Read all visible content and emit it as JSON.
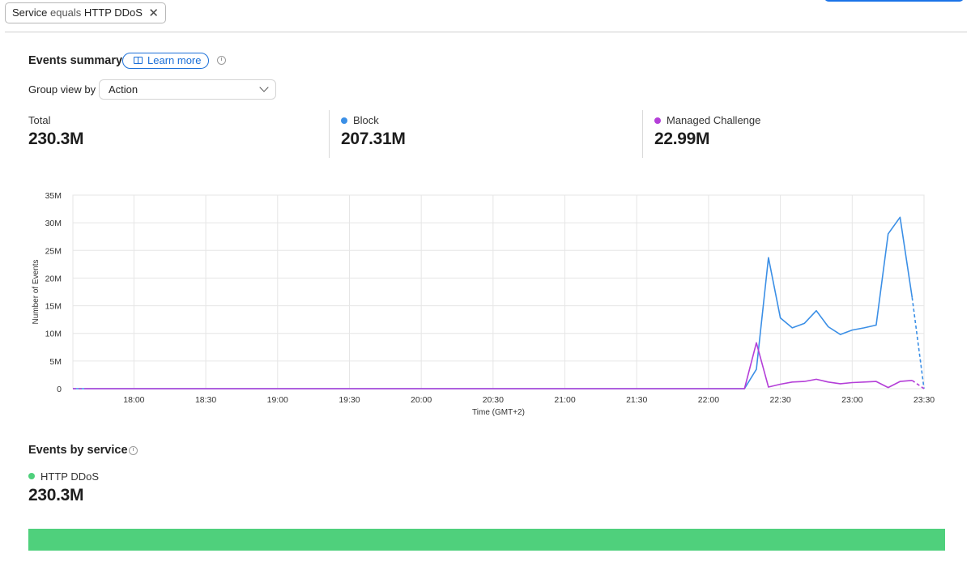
{
  "filter": {
    "field": "Service",
    "operator": "equals",
    "value": "HTTP DDoS",
    "clear_icon": "close-icon"
  },
  "events_summary": {
    "title": "Events summary",
    "learn_more": "Learn more",
    "group_view_label": "Group view by",
    "group_view_value": "Action",
    "stats": [
      {
        "label": "Total",
        "value": "230.3M"
      },
      {
        "label": "Block",
        "value": "207.31M",
        "color": "#3b8fe6"
      },
      {
        "label": "Managed Challenge",
        "value": "22.99M",
        "color": "#b43fd8"
      }
    ]
  },
  "chart_data": {
    "type": "line",
    "xlabel": "Time (GMT+2)",
    "ylabel": "Number of Events",
    "ylim": [
      0,
      35
    ],
    "y_ticks": [
      "0",
      "5M",
      "10M",
      "15M",
      "20M",
      "25M",
      "30M",
      "35M"
    ],
    "x_ticks": [
      "18:00",
      "18:30",
      "19:00",
      "19:30",
      "20:00",
      "20:30",
      "21:00",
      "21:30",
      "22:00",
      "22:30",
      "23:00",
      "23:30"
    ],
    "x_range_hours": [
      17.575,
      23.5
    ],
    "grid": true,
    "series": [
      {
        "name": "Block",
        "color": "#3b8fe6",
        "points": [
          [
            17.575,
            0
          ],
          [
            22.25,
            0
          ],
          [
            22.333,
            3.5
          ],
          [
            22.417,
            23.7
          ],
          [
            22.5,
            12.8
          ],
          [
            22.583,
            11.0
          ],
          [
            22.667,
            11.8
          ],
          [
            22.75,
            14.1
          ],
          [
            22.833,
            11.2
          ],
          [
            22.917,
            9.8
          ],
          [
            23.0,
            10.6
          ],
          [
            23.083,
            11.0
          ],
          [
            23.167,
            11.5
          ],
          [
            23.25,
            28.0
          ],
          [
            23.333,
            31.0
          ],
          [
            23.417,
            16.5
          ]
        ],
        "dashed_tail": [
          [
            23.417,
            16.5
          ],
          [
            23.5,
            0
          ]
        ]
      },
      {
        "name": "Managed Challenge",
        "color": "#b43fd8",
        "dashed_head": [
          [
            17.575,
            0
          ],
          [
            17.67,
            0
          ]
        ],
        "points": [
          [
            17.67,
            0
          ],
          [
            22.25,
            0
          ],
          [
            22.333,
            8.3
          ],
          [
            22.417,
            0.3
          ],
          [
            22.5,
            0.8
          ],
          [
            22.583,
            1.2
          ],
          [
            22.667,
            1.3
          ],
          [
            22.75,
            1.7
          ],
          [
            22.833,
            1.2
          ],
          [
            22.917,
            0.9
          ],
          [
            23.0,
            1.1
          ],
          [
            23.083,
            1.2
          ],
          [
            23.167,
            1.3
          ],
          [
            23.25,
            0.2
          ],
          [
            23.333,
            1.3
          ],
          [
            23.417,
            1.5
          ]
        ],
        "dashed_tail": [
          [
            23.417,
            1.5
          ],
          [
            23.5,
            0
          ]
        ]
      }
    ]
  },
  "events_by_service": {
    "title": "Events by service",
    "service_name": "HTTP DDoS",
    "service_value": "230.3M",
    "service_fraction": 1.0,
    "color": "#4fd07c"
  }
}
